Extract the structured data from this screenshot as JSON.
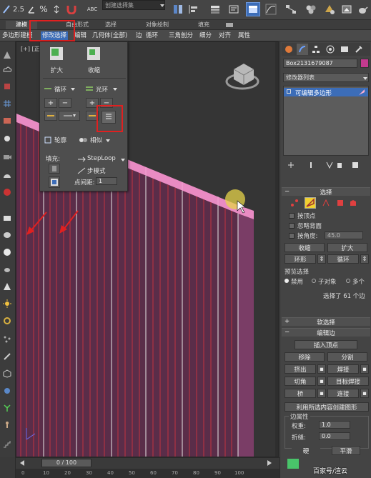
{
  "toolbar": {
    "snap_2_5": "2.5",
    "percent_snap": "%",
    "abc": "ABC",
    "selection_set_placeholder": "创建选择集"
  },
  "ribbon_tabs": [
    "建模",
    "自由形式",
    "选择",
    "对象绘制",
    "填充"
  ],
  "ribbon": {
    "polygon_modeling": "多边形建模",
    "modify_selection": "修改选择",
    "edit": "编辑",
    "geometry_all": "几何体(全部)",
    "edges": "边",
    "loops": "循环",
    "tris": "三角剖分",
    "subdivision": "细分",
    "align": "对齐",
    "properties": "属性"
  },
  "viewport": {
    "label": "[+] [正"
  },
  "popup": {
    "grow": "扩大",
    "shrink": "收缩",
    "loop": "循环",
    "ring": "光环",
    "outline": "轮廓",
    "similar": "相似",
    "fill": "填充:",
    "steploop": "StepLoop",
    "step_mode": "步模式",
    "point_distance_label": "点间距:",
    "point_distance_value": "1"
  },
  "right_panel": {
    "object_name": "Box2131679087",
    "modifier_list": "修改器列表",
    "stack_item": "可编辑多边形",
    "selection_title": "选择",
    "by_vertex": "按顶点",
    "ignore_backfacing": "忽略背面",
    "by_angle": "按角度:",
    "angle_value": "45.0",
    "shrink": "收缩",
    "grow": "扩大",
    "ring": "环形",
    "loop": "循环",
    "preview_selection": "预览选择",
    "disabled": "禁用",
    "subobject": "子对象",
    "multiple": "多个",
    "selected_count": "选择了 61 个边",
    "soft_selection": "软选择",
    "edit_edges": "编辑边",
    "insert_vertex": "插入顶点",
    "remove": "移除",
    "split": "分割",
    "extrude": "挤出",
    "weld": "焊接",
    "chamfer": "切角",
    "target_weld": "目标焊接",
    "bridge": "桥",
    "connect": "连接",
    "create_shape": "利用所选内容创建图形",
    "edge_properties": "边属性",
    "weight_label": "权重:",
    "weight_value": "1.0",
    "crease_label": "折缝:",
    "crease_value": "0.0",
    "hard": "硬",
    "smooth": "平滑"
  },
  "timeline": {
    "frame": "0 / 100",
    "ticks": [
      "0",
      "10",
      "20",
      "30",
      "40",
      "50",
      "60",
      "70",
      "80",
      "90",
      "100"
    ]
  },
  "watermark": "百家号/渲云",
  "colors": {
    "wall_fill": "#5a2d49",
    "edge_selected": "#c23440",
    "highlight_box": "#e02020",
    "selection_blue": "#3c6db8"
  }
}
